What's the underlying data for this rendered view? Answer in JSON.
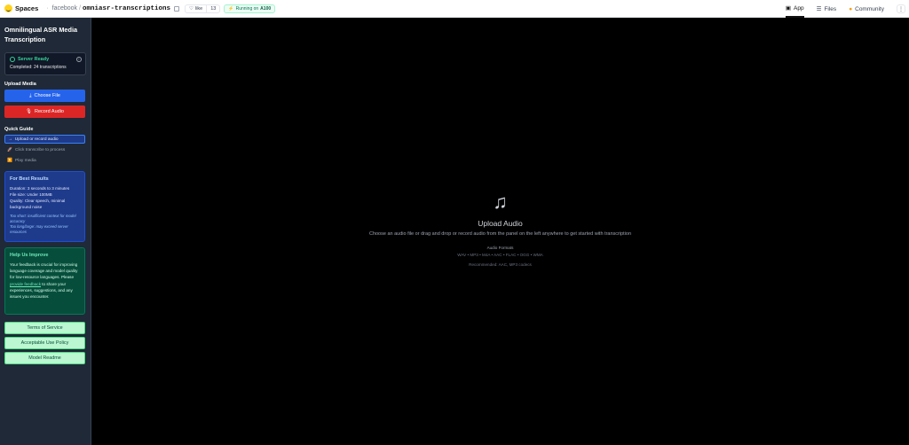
{
  "topbar": {
    "brand": "Spaces",
    "org": "facebook",
    "repo": "omniasr-transcriptions",
    "like_label": "like",
    "like_count": "13",
    "status_prefix": "Running on",
    "status_hw": "A100",
    "tabs": [
      {
        "label": "App",
        "icon": "app-icon",
        "active": true
      },
      {
        "label": "Files",
        "icon": "files-icon",
        "active": false
      },
      {
        "label": "Community",
        "icon": "community-icon",
        "active": false
      }
    ],
    "more": "⋮"
  },
  "sidebar": {
    "title": "Omnilingual ASR Media Transcription",
    "status": {
      "label": "Server Ready",
      "sub": "Completed: 24 transcriptions",
      "color": "#34d399"
    },
    "upload_section": "Upload Media",
    "choose_file": "Choose File",
    "record_audio": "Record Audio",
    "guide_section": "Quick Guide",
    "guide": [
      {
        "icon": "→",
        "label": "Upload or record audio",
        "active": true
      },
      {
        "icon": "🚀",
        "label": "Click transcribe to process",
        "active": false
      },
      {
        "icon": "▶️",
        "label": "Play media",
        "active": false
      }
    ],
    "best": {
      "title": "For Best Results",
      "lines": [
        "Duration: 3 seconds to 3 minutes",
        "File size: Under 100MB",
        "Quality: Clear speech, minimal background noise"
      ],
      "notes": [
        "Too short: insufficient context for model accuracy",
        "Too long/large: may exceed server resources"
      ]
    },
    "help": {
      "title": "Help Us Improve",
      "text_before": "Your feedback is crucial for improving language coverage and model quality for low-resource languages. Please",
      "link": "provide feedback",
      "text_after": "to share your experiences, suggestions, and any issues you encounter."
    },
    "links": [
      "Terms of Service",
      "Acceptable Use Policy",
      "Model Readme"
    ]
  },
  "main": {
    "icon": "music-note-icon",
    "title": "Upload Audio",
    "description": "Choose an audio file or drag and drop or record audio from the panel on the left anywhere to get started with transcription",
    "formats_label": "Audio Formats",
    "formats": "WAV • MP3 • M4A • AAC • FLAC • OGG • WMA",
    "recommended": "Recommended: AAC, MP3 codecs"
  }
}
